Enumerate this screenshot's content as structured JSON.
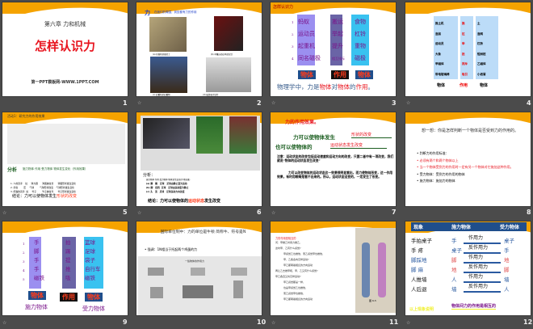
{
  "slides": [
    {
      "number": "1",
      "chapter": "第六章 力和机械",
      "title": "怎样认识力",
      "footer": "第一PPT模板网-WWW.1PPT.COM"
    },
    {
      "number": "2",
      "heading": "力",
      "subtitle": "在我们的周围，到处都有力的作用",
      "captions": [
        "(a) 挖掘机挖掘泥土",
        "(b) 举重运动员举起杠铃",
        "(c) 起重机吊起重物",
        "(d) 磁铁吸引铁钉"
      ]
    },
    {
      "number": "3",
      "heading": "怎样认识力",
      "rows": [
        {
          "n": "1",
          "a": "蚂蚁",
          "b": "搬运",
          "c": "食物"
        },
        {
          "n": "2",
          "a": "运动员",
          "b": "举起",
          "c": "杠铃"
        },
        {
          "n": "3",
          "a": "起重机",
          "b": "提升",
          "c": "重物"
        },
        {
          "n": "4",
          "a": "同名磁极",
          "b": "相互排斥",
          "c": "磁极"
        }
      ],
      "tags": [
        "物体",
        "作用",
        "物体"
      ],
      "conclusion_parts": [
        "物理学中，力是",
        "物体",
        "对",
        "物体",
        "的",
        "作用",
        "。"
      ]
    },
    {
      "number": "4",
      "rows": [
        {
          "a": "推土机",
          "b": "推",
          "c": "土"
        },
        {
          "a": "渔翁",
          "b": "拉",
          "c": "渔网"
        },
        {
          "a": "运动员",
          "b": "举",
          "c": "杠铃"
        },
        {
          "a": "大象",
          "b": "抵",
          "c": "短树枝"
        },
        {
          "a": "甲磁体",
          "b": "排斥",
          "c": "乙磁体"
        },
        {
          "a": "带电玻璃棒",
          "b": "吸引",
          "c": "小纸屑"
        }
      ],
      "footer": [
        "物体",
        "作用",
        "物体"
      ]
    },
    {
      "number": "5",
      "heading": "活动1：研究力的作用效果",
      "analysis_label": "分析",
      "analysis_header": "施力物体  作用  受力物体  物体发生变化（作用效果）",
      "lines": [
        "1. 人的双手    拉     弹力器      弹簧被拉长      弹簧形状发生变化",
        "2. 手指        压     气球        气球形状改变    气球形状发生变化",
        "3. 熊猫的双手  拉     竹子        竹子被拉弯      竹子形状发生变化"
      ],
      "conclusion": "结论：力可以使物体发生",
      "conclusion_red": "形状的改变"
    },
    {
      "number": "6",
      "analysis_label": "分析：",
      "analysis_header": "施力物体 作用 受力物体 物体发生变化(作用效果)",
      "lines": [
        "(a) 脚   踢   足球   足球由静止变为运动",
        "(b) 脚   抵挡  足球   足球由运动变为静止",
        "(c) 头   顶   足球   足球运动方向改变"
      ],
      "conclusion": "结论：力可以使物体的",
      "conclusion_red": "运动状态",
      "conclusion_end": "发生改变"
    },
    {
      "number": "7",
      "heading": "力的作用效果。",
      "line1": "力可以使物体发生",
      "blank1": "形状的改变",
      "line2": "也可以使物体的",
      "blank2": "运动状态发生改变",
      "note": "注意：运动状态的改变包括运动速度和运动方向的改变，只要二者中有一项改变，我们就说“物体的运动状态发生改变”",
      "note2": "力可以改变物体的运动状态这一效果很明显看出，而力使物体形变，这一作用效果，有时用眼睛是看不出来的。所以，运动状态没变的，一定发生了形变。"
    },
    {
      "number": "8",
      "question": "想一想：你是怎样判断一个物体是否受到力的作用的。",
      "bullets": [
        {
          "text": "判断力的作用标准：",
          "red": false
        },
        {
          "text": "必须有两个和两个物体以上",
          "red": true
        },
        {
          "text": "当一个物体受到力的作用时一定有另一个物体对它施加这种作用。",
          "red": true
        },
        {
          "text": "受力物体：受到力的作用的物体",
          "red": false
        },
        {
          "text": "施力物体：施加力的物体",
          "red": false
        }
      ]
    },
    {
      "number": "9",
      "nums": [
        "1",
        "2",
        "3",
        "4",
        "5"
      ],
      "col_a": [
        "手",
        "脚",
        "手",
        "手",
        "磁铁"
      ],
      "col_b": [
        "拍",
        "踢",
        "提",
        "推",
        "吸"
      ],
      "col_c": [
        "篮球",
        "足球",
        "袋子",
        "自行车",
        "磁铁"
      ],
      "tags": [
        "物体",
        "作用",
        "物体"
      ],
      "labels": [
        "施力物体",
        "受力物体"
      ]
    },
    {
      "number": "10",
      "title": "国际单位制中：力的单位是牛顿 简称牛、符号是N",
      "bullet": "强调：1N相当于托起两个鸡蛋的力",
      "figure_title": "一些物体的作用力"
    },
    {
      "number": "11",
      "heading": "力的作用是相互的",
      "lines": [
        "问：甲推乙时用力推乙，",
        "这时甲、乙有什么感觉?",
        "甲感觉乙也推他，而乙感觉甲也推他，",
        "甲、乙各会向怎样运动?",
        "甲乙都朝着相反的方向运动",
        "再让乙去推甲呢，甲、乙又有什么感觉?",
        "甲乙各自又将怎样运动?",
        "甲乙感觉都是一样，",
        "也是甲感觉乙也推他，",
        "而乙感觉甲也推他，",
        "甲乙都朝着相反的方向运动"
      ],
      "fig": "图 6-5"
    },
    {
      "number": "12",
      "header": [
        "现象",
        "施力物体",
        "受力物体"
      ],
      "rows": [
        {
          "p": "手拍桌子",
          "s": "手",
          "f": "作用力",
          "r": "桌子"
        },
        {
          "p": "手 疼",
          "s": "桌子",
          "f": "反作用力",
          "r": "手"
        },
        {
          "p": "脚踩地",
          "s": "脚",
          "f": "作用力",
          "r": "地"
        },
        {
          "p": "脚 麻",
          "s": "地",
          "f": "反作用力",
          "r": "脚"
        },
        {
          "p": "人推墙",
          "s": "人",
          "f": "作用力",
          "r": "墙"
        },
        {
          "p": "人后退",
          "s": "墙",
          "f": "反作用力",
          "r": "人"
        }
      ],
      "summary": "以上现象说明",
      "summary_end": "物体间力的作用是相互的"
    }
  ],
  "transition_icon_label": "☆"
}
